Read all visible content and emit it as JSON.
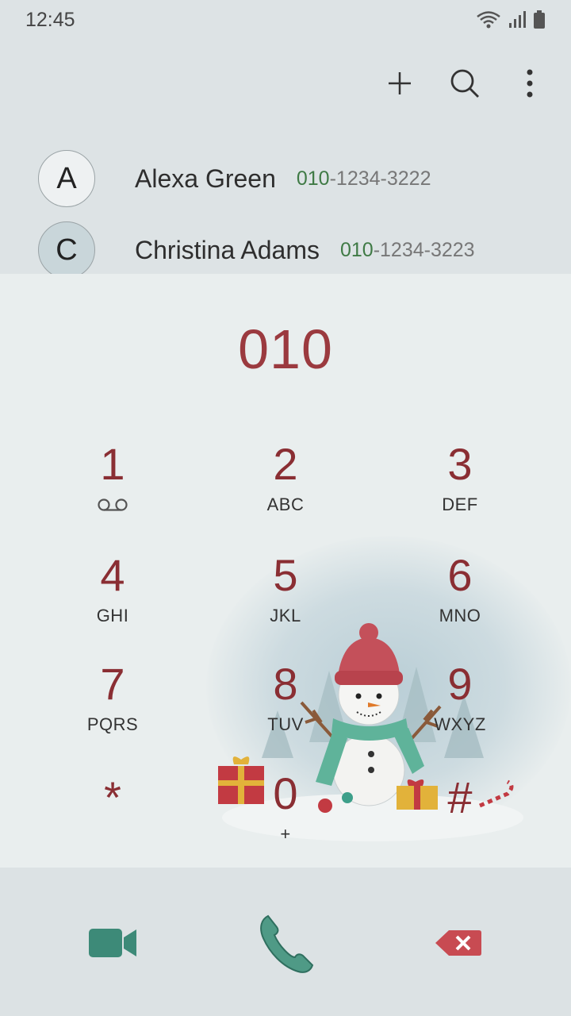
{
  "status_bar": {
    "time": "12:45"
  },
  "contacts": [
    {
      "initial": "A",
      "name": "Alexa Green",
      "number_match": "010",
      "number_rest": "-1234-3222"
    },
    {
      "initial": "C",
      "name": "Christina Adams",
      "number_match": "010",
      "number_rest": "-1234-3223"
    }
  ],
  "dial": {
    "number": "010"
  },
  "keys": [
    {
      "digit": "1",
      "letters": ""
    },
    {
      "digit": "2",
      "letters": "ABC"
    },
    {
      "digit": "3",
      "letters": "DEF"
    },
    {
      "digit": "4",
      "letters": "GHI"
    },
    {
      "digit": "5",
      "letters": "JKL"
    },
    {
      "digit": "6",
      "letters": "MNO"
    },
    {
      "digit": "7",
      "letters": "PQRS"
    },
    {
      "digit": "8",
      "letters": "TUV"
    },
    {
      "digit": "9",
      "letters": "WXYZ"
    },
    {
      "digit": "*",
      "letters": ""
    },
    {
      "digit": "0",
      "letters": "+"
    },
    {
      "digit": "#",
      "letters": ""
    }
  ],
  "icons": {
    "toolbar": [
      "plus-icon",
      "search-icon",
      "more-vertical-icon"
    ],
    "bottom": [
      "video-call-icon",
      "phone-call-icon",
      "backspace-icon"
    ]
  },
  "colors": {
    "digit": "#8a2e33",
    "dialed_number": "#9b3a3f",
    "match_highlight": "#3f7a45",
    "video_icon": "#3d8a78",
    "call_icon": "#4f9a86",
    "backspace_icon": "#c84b52"
  }
}
